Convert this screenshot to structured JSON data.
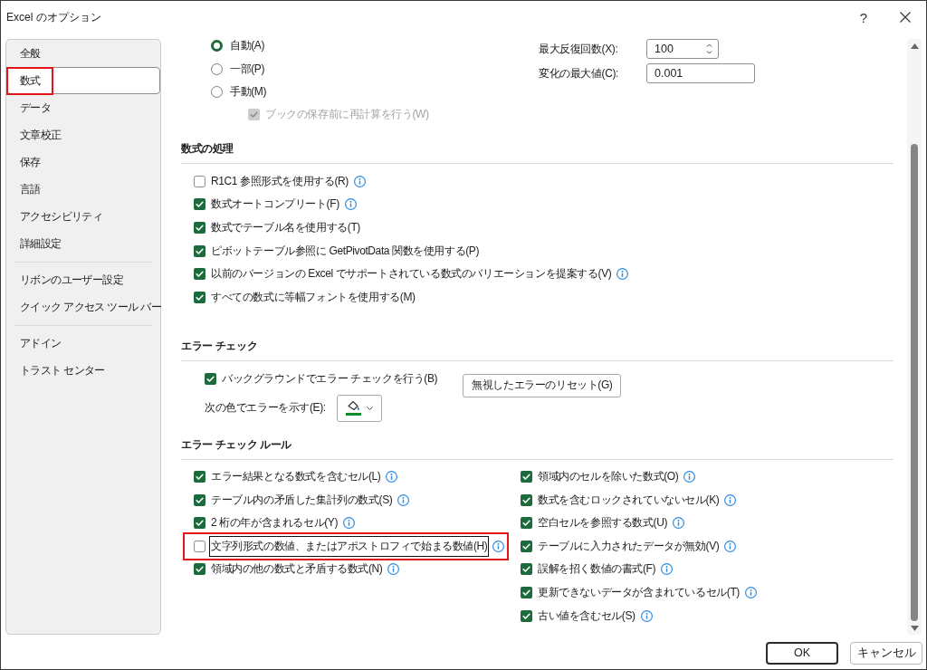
{
  "window": {
    "title": "Excel のオプション",
    "help": "?"
  },
  "sidebar": {
    "groups": [
      {
        "items": [
          {
            "label": "全般",
            "selected": false,
            "highlighted": false
          },
          {
            "label": "数式",
            "selected": true,
            "highlighted": true
          },
          {
            "label": "データ",
            "selected": false,
            "highlighted": false
          },
          {
            "label": "文章校正",
            "selected": false,
            "highlighted": false
          },
          {
            "label": "保存",
            "selected": false,
            "highlighted": false
          },
          {
            "label": "言語",
            "selected": false,
            "highlighted": false
          },
          {
            "label": "アクセシビリティ",
            "selected": false,
            "highlighted": false
          },
          {
            "label": "詳細設定",
            "selected": false,
            "highlighted": false
          }
        ]
      },
      {
        "items": [
          {
            "label": "リボンのユーザー設定",
            "selected": false,
            "highlighted": false
          },
          {
            "label": "クイック アクセス ツール バー",
            "selected": false,
            "highlighted": false
          }
        ]
      },
      {
        "items": [
          {
            "label": "アドイン",
            "selected": false,
            "highlighted": false
          },
          {
            "label": "トラスト センター",
            "selected": false,
            "highlighted": false
          }
        ]
      }
    ]
  },
  "calculation": {
    "modes": [
      {
        "label": "自動(A)",
        "selected": true
      },
      {
        "label": "一部(P)",
        "selected": false
      },
      {
        "label": "手動(M)",
        "selected": false
      }
    ],
    "recalc_before_save": {
      "label": "ブックの保存前に再計算を行う(W)",
      "checked": true,
      "disabled": true
    },
    "max_iterations": {
      "label": "最大反復回数(X):",
      "value": "100"
    },
    "max_change": {
      "label": "変化の最大値(C):",
      "value": "0.001"
    }
  },
  "formula_handling": {
    "heading": "数式の処理",
    "options": [
      {
        "label": "R1C1 参照形式を使用する(R)",
        "checked": false,
        "info": true
      },
      {
        "label": "数式オートコンプリート(F)",
        "checked": true,
        "info": true
      },
      {
        "label": "数式でテーブル名を使用する(T)",
        "checked": true,
        "info": false
      },
      {
        "label": "ピボットテーブル参照に GetPivotData 関数を使用する(P)",
        "checked": true,
        "info": false
      },
      {
        "label": "以前のバージョンの Excel でサポートされている数式のバリエーションを提案する(V)",
        "checked": true,
        "info": true
      },
      {
        "label": "すべての数式に等幅フォントを使用する(M)",
        "checked": true,
        "info": false
      }
    ]
  },
  "error_checking": {
    "heading": "エラー チェック",
    "background_check": {
      "label": "バックグラウンドでエラー チェックを行う(B)",
      "checked": true
    },
    "color_label": "次の色でエラーを示す(E):",
    "color": "#0a8a2a",
    "reset_button": "無視したエラーのリセット(G)"
  },
  "error_rules": {
    "heading": "エラー チェック ルール",
    "left": [
      {
        "label": "エラー結果となる数式を含むセル(L)",
        "checked": true,
        "info": true,
        "highlighted": false,
        "focused": false
      },
      {
        "label": "テーブル内の矛盾した集計列の数式(S)",
        "checked": true,
        "info": true,
        "highlighted": false,
        "focused": false
      },
      {
        "label": "2 桁の年が含まれるセル(Y)",
        "checked": true,
        "info": true,
        "highlighted": false,
        "focused": false
      },
      {
        "label": "文字列形式の数値、またはアポストロフィで始まる数値(H)",
        "checked": false,
        "info": true,
        "highlighted": true,
        "focused": true
      },
      {
        "label": "領域内の他の数式と矛盾する数式(N)",
        "checked": true,
        "info": true,
        "highlighted": false,
        "focused": false
      }
    ],
    "right": [
      {
        "label": "領域内のセルを除いた数式(O)",
        "checked": true,
        "info": true
      },
      {
        "label": "数式を含むロックされていないセル(K)",
        "checked": true,
        "info": true
      },
      {
        "label": "空白セルを参照する数式(U)",
        "checked": true,
        "info": true
      },
      {
        "label": "テーブルに入力されたデータが無効(V)",
        "checked": true,
        "info": true
      },
      {
        "label": "誤解を招く数値の書式(F)",
        "checked": true,
        "info": true
      },
      {
        "label": "更新できないデータが含まれているセル(T)",
        "checked": true,
        "info": true
      },
      {
        "label": "古い値を含むセル(S)",
        "checked": true,
        "info": true
      }
    ]
  },
  "buttons": [
    {
      "label": "OK",
      "default": true
    },
    {
      "label": "キャンセル",
      "default": false
    }
  ]
}
